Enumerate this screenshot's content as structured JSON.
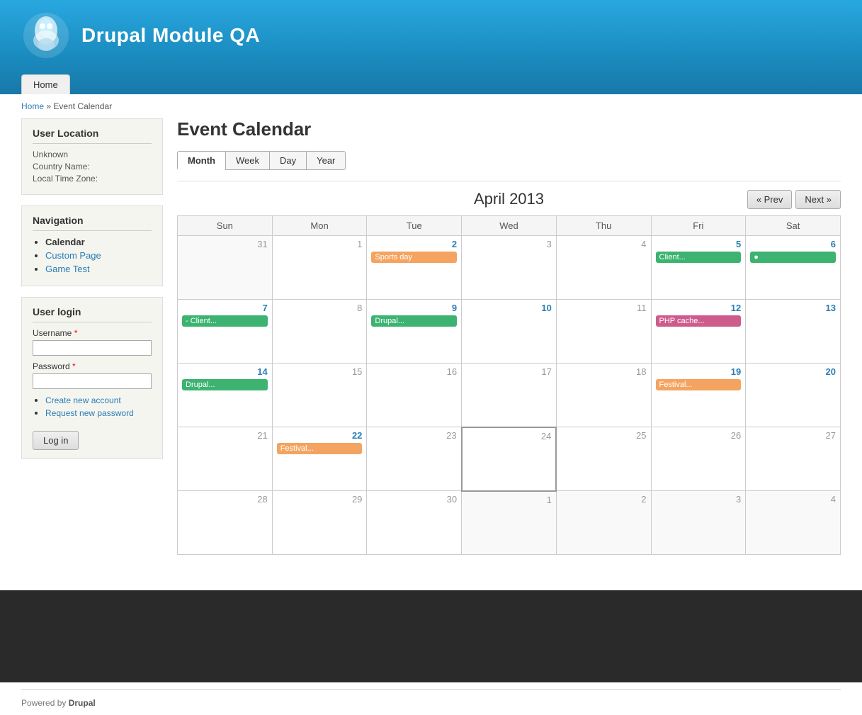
{
  "site": {
    "title": "Drupal Module QA"
  },
  "nav": {
    "home_label": "Home"
  },
  "breadcrumb": {
    "home": "Home",
    "separator": "»",
    "current": "Event Calendar"
  },
  "sidebar": {
    "user_location": {
      "title": "User Location",
      "unknown": "Unknown",
      "country_label": "Country Name:",
      "timezone_label": "Local Time Zone:"
    },
    "navigation": {
      "title": "Navigation",
      "items": [
        {
          "label": "Calendar",
          "active": true,
          "link": false
        },
        {
          "label": "Custom Page",
          "active": false,
          "link": true
        },
        {
          "label": "Game Test",
          "active": false,
          "link": true
        }
      ]
    },
    "user_login": {
      "title": "User login",
      "username_label": "Username",
      "password_label": "Password",
      "create_account": "Create new account",
      "request_password": "Request new password",
      "login_button": "Log in"
    }
  },
  "calendar": {
    "page_title": "Event Calendar",
    "view_tabs": [
      "Month",
      "Week",
      "Day",
      "Year"
    ],
    "active_tab": "Month",
    "month_title": "April 2013",
    "prev_label": "« Prev",
    "next_label": "Next »",
    "day_headers": [
      "Sun",
      "Mon",
      "Tue",
      "Wed",
      "Thu",
      "Fri",
      "Sat"
    ],
    "weeks": [
      [
        {
          "num": "31",
          "other": true,
          "events": []
        },
        {
          "num": "1",
          "other": false,
          "events": []
        },
        {
          "num": "2",
          "other": false,
          "has_event": true,
          "events": [
            {
              "label": "Sports day",
              "color": "event-orange"
            }
          ]
        },
        {
          "num": "3",
          "other": false,
          "events": []
        },
        {
          "num": "4",
          "other": false,
          "events": []
        },
        {
          "num": "5",
          "other": false,
          "has_event": true,
          "events": [
            {
              "label": "Client...",
              "color": "event-green",
              "continues": true
            }
          ]
        },
        {
          "num": "6",
          "other": false,
          "has_event": true,
          "events": [
            {
              "label": "",
              "color": "event-green",
              "dot": true
            }
          ]
        }
      ],
      [
        {
          "num": "7",
          "other": false,
          "has_event": true,
          "events": [
            {
              "label": "- Client...",
              "color": "event-green"
            }
          ]
        },
        {
          "num": "8",
          "other": false,
          "events": []
        },
        {
          "num": "9",
          "other": false,
          "has_event": true,
          "events": [
            {
              "label": "Drupal...",
              "color": "event-green"
            }
          ]
        },
        {
          "num": "10",
          "other": false,
          "has_event": true,
          "events": []
        },
        {
          "num": "11",
          "other": false,
          "events": []
        },
        {
          "num": "12",
          "other": false,
          "has_event": true,
          "events": [
            {
              "label": "PHP cache...",
              "color": "event-pink"
            }
          ]
        },
        {
          "num": "13",
          "other": false,
          "events": []
        }
      ],
      [
        {
          "num": "14",
          "other": false,
          "has_event": true,
          "events": [
            {
              "label": "Drupal...",
              "color": "event-green"
            }
          ]
        },
        {
          "num": "15",
          "other": false,
          "events": []
        },
        {
          "num": "16",
          "other": false,
          "events": []
        },
        {
          "num": "17",
          "other": false,
          "events": []
        },
        {
          "num": "18",
          "other": false,
          "events": []
        },
        {
          "num": "19",
          "other": false,
          "has_event": true,
          "events": [
            {
              "label": "Festival...",
              "color": "event-orange"
            }
          ]
        },
        {
          "num": "20",
          "other": false,
          "events": []
        }
      ],
      [
        {
          "num": "21",
          "other": false,
          "events": []
        },
        {
          "num": "22",
          "other": false,
          "has_event": true,
          "events": [
            {
              "label": "Festival...",
              "color": "event-orange"
            }
          ]
        },
        {
          "num": "23",
          "other": false,
          "events": []
        },
        {
          "num": "24",
          "other": false,
          "today": true,
          "events": []
        },
        {
          "num": "25",
          "other": false,
          "events": []
        },
        {
          "num": "26",
          "other": false,
          "events": []
        },
        {
          "num": "27",
          "other": false,
          "events": []
        }
      ],
      [
        {
          "num": "28",
          "other": false,
          "events": []
        },
        {
          "num": "29",
          "other": false,
          "events": []
        },
        {
          "num": "30",
          "other": false,
          "events": []
        },
        {
          "num": "1",
          "other": true,
          "events": []
        },
        {
          "num": "2",
          "other": true,
          "events": []
        },
        {
          "num": "3",
          "other": true,
          "events": []
        },
        {
          "num": "4",
          "other": true,
          "events": []
        }
      ]
    ]
  },
  "footer": {
    "powered_by": "Powered by",
    "drupal": "Drupal"
  }
}
